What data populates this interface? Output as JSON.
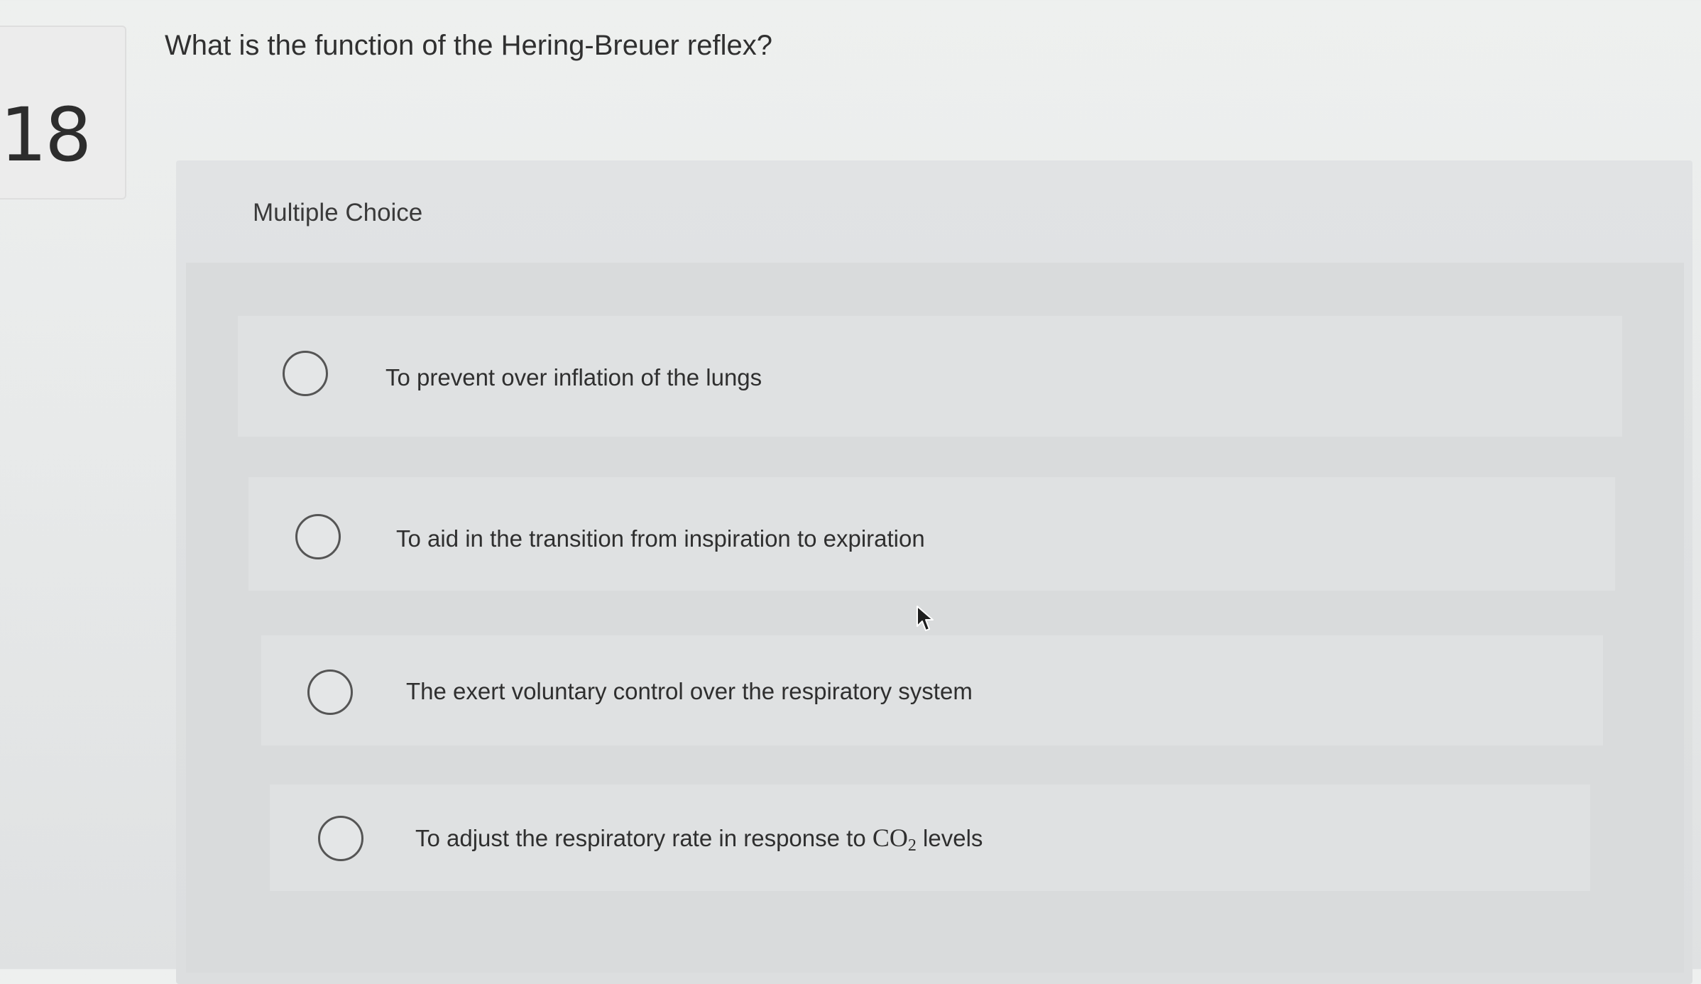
{
  "question": {
    "number": "18",
    "text": "What is the function of the Hering-Breuer reflex?"
  },
  "panel": {
    "label": "Multiple Choice"
  },
  "options": [
    {
      "text": "To prevent over inflation of the lungs"
    },
    {
      "text": "To aid in the transition from inspiration to expiration"
    },
    {
      "text": "The exert voluntary control over the respiratory system"
    },
    {
      "text_before": "To adjust the respiratory rate in response to",
      "formula_base": "CO",
      "formula_sub": "2",
      "text_after": "levels"
    }
  ],
  "icons": {
    "radio": "radio-unselected-icon",
    "cursor": "mouse-pointer-icon"
  }
}
